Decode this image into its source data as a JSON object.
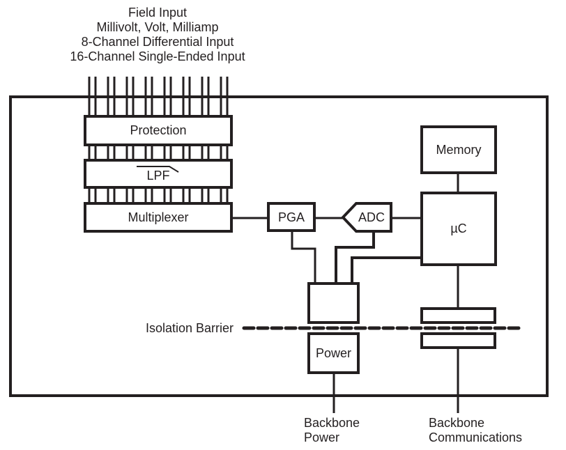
{
  "diagram": {
    "title_lines": [
      "Field Input",
      "Millivolt, Volt, Milliamp",
      "8-Channel Differential Input",
      "16-Channel Single-Ended Input"
    ],
    "blocks": {
      "protection": "Protection",
      "lpf": "LPF",
      "multiplexer": "Multiplexer",
      "pga": "PGA",
      "adc": "ADC",
      "memory": "Memory",
      "microcontroller": "µC",
      "power": "Power",
      "isolated_supply": "",
      "comm_isolator_upper": "",
      "comm_isolator_lower": ""
    },
    "isolation_label": "Isolation Barrier",
    "outputs": {
      "power": [
        "Backbone",
        "Power"
      ],
      "communications": [
        "Backbone",
        "Communications"
      ]
    },
    "input_channel_pairs": 8,
    "line_color": "#231f20"
  }
}
